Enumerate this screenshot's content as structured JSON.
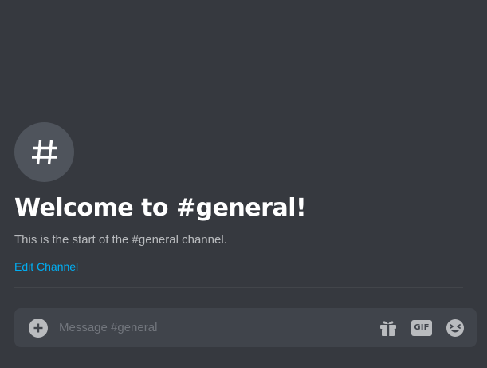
{
  "channel": {
    "hash_symbol": "#",
    "welcome_title": "Welcome to #general!",
    "welcome_subtitle": "This is the start of the #general channel.",
    "edit_link_label": "Edit Channel"
  },
  "composer": {
    "placeholder": "Message #general",
    "value": "",
    "buttons": {
      "attach_icon": "plus-circle-icon",
      "gift_icon": "gift-icon",
      "gif_label": "GIF",
      "emoji_icon": "emoji-icon"
    }
  },
  "colors": {
    "background": "#36393f",
    "composer_background": "#40444b",
    "avatar_background": "#4f545c",
    "title": "#ffffff",
    "subtitle": "#b9bbbe",
    "link": "#00aff4",
    "icon": "#b9bbbe"
  }
}
